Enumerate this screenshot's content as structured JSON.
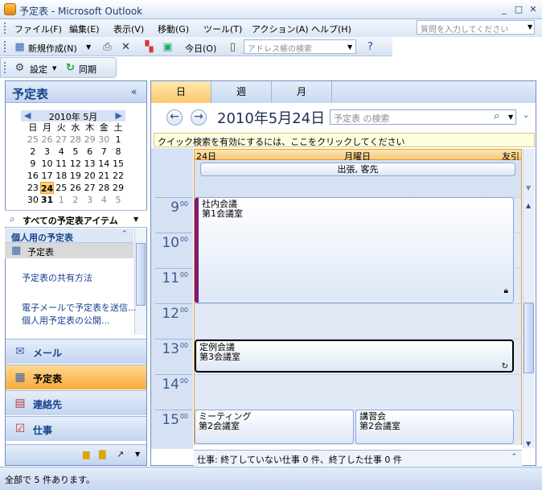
{
  "window": {
    "title": "予定表 - Microsoft Outlook",
    "min": "_",
    "max": "□",
    "close": "✕"
  },
  "menu": {
    "items": [
      "ファイル(F)",
      "編集(E)",
      "表示(V)",
      "移動(G)",
      "ツール(T)",
      "アクション(A)",
      "ヘルプ(H)"
    ],
    "help_placeholder": "質問を入力してください"
  },
  "toolbar": {
    "new_label": "新規作成(N)",
    "today_label": "今日(O)",
    "address_search_placeholder": "アドレス帳の検索"
  },
  "toolbar2": {
    "settings_label": "設定",
    "sync_label": "同期"
  },
  "nav": {
    "title": "予定表",
    "month_label": "2010年 5月",
    "weekdays": [
      "日",
      "月",
      "火",
      "水",
      "木",
      "金",
      "土"
    ],
    "weeks": [
      [
        "25",
        "26",
        "27",
        "28",
        "29",
        "30",
        "1"
      ],
      [
        "2",
        "3",
        "4",
        "5",
        "6",
        "7",
        "8"
      ],
      [
        "9",
        "10",
        "11",
        "12",
        "13",
        "14",
        "15"
      ],
      [
        "16",
        "17",
        "18",
        "19",
        "20",
        "21",
        "22"
      ],
      [
        "23",
        "24",
        "25",
        "26",
        "27",
        "28",
        "29"
      ],
      [
        "30",
        "31",
        "1",
        "2",
        "3",
        "4",
        "5"
      ]
    ],
    "all_items_label": "すべての予定表アイテム",
    "personal_section": "個人用の予定表",
    "calendar_item": "予定表",
    "link_share": "予定表の共有方法",
    "link_email": "電子メールで予定表を送信...",
    "link_publish": "個人用予定表の公開...",
    "buttons": {
      "mail": "メール",
      "calendar": "予定表",
      "contacts": "連絡先",
      "tasks": "仕事"
    }
  },
  "view": {
    "tab_day": "日",
    "tab_week": "週",
    "tab_month": "月",
    "date_title": "2010年5月24日",
    "search_placeholder": "予定表 の検索",
    "infobar": "クイック検索を有効にするには、ここをクリックしてください",
    "day_num": "24日",
    "day_name": "月曜日",
    "day_right": "友引",
    "allday_event": "出張, 客先",
    "hours": [
      "9",
      "10",
      "11",
      "12",
      "13",
      "14",
      "15"
    ],
    "minutes": "00",
    "appointments": [
      {
        "title": "社内会議",
        "location": "第1会議室"
      },
      {
        "title": "定例会議",
        "location": "第3会議室"
      },
      {
        "title": "ミーティング",
        "location": "第2会議室"
      },
      {
        "title": "講習会",
        "location": "第2会議室"
      }
    ],
    "taskbar": "仕事: 終了していない仕事 0 件、終了した仕事 0 件"
  },
  "status": {
    "text": "全部で 5 件あります。"
  }
}
